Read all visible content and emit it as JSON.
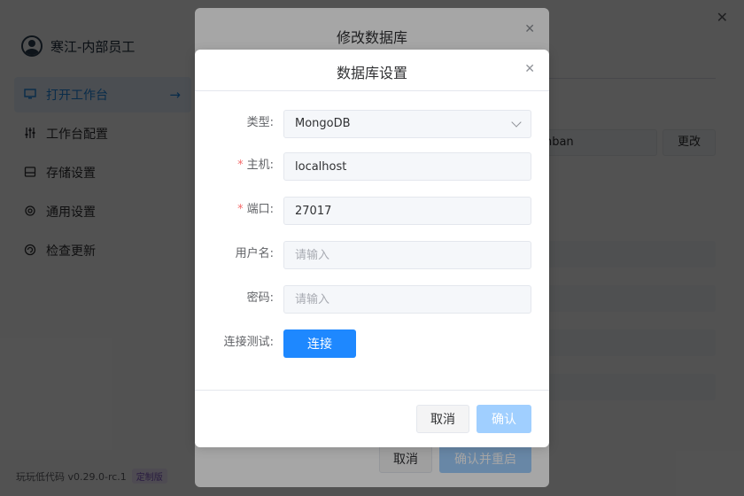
{
  "app": {
    "user_name": "寒江-内部员工",
    "nav": [
      {
        "label": "打开工作台",
        "icon": "monitor-icon"
      },
      {
        "label": "工作台配置",
        "icon": "sliders-icon"
      },
      {
        "label": "存储设置",
        "icon": "storage-icon"
      },
      {
        "label": "通用设置",
        "icon": "gear-icon"
      },
      {
        "label": "检查更新",
        "icon": "refresh-icon"
      }
    ],
    "version": "玩玩低代码 v0.29.0-rc.1",
    "version_badge": "定制版",
    "path_value": "anban",
    "change_label": "更改"
  },
  "outer_dialog": {
    "title": "修改数据库",
    "cancel_label": "取消",
    "confirm_label": "确认并重启"
  },
  "inner_dialog": {
    "title": "数据库设置",
    "fields": {
      "type_label": "类型:",
      "type_value": "MongoDB",
      "host_label": "主机:",
      "host_value": "localhost",
      "port_label": "端口:",
      "port_value": "27017",
      "username_label": "用户名:",
      "username_placeholder": "请输入",
      "password_label": "密码:",
      "password_placeholder": "请输入",
      "test_label": "连接测试:",
      "connect_label": "连接"
    },
    "cancel_label": "取消",
    "confirm_label": "确认"
  }
}
